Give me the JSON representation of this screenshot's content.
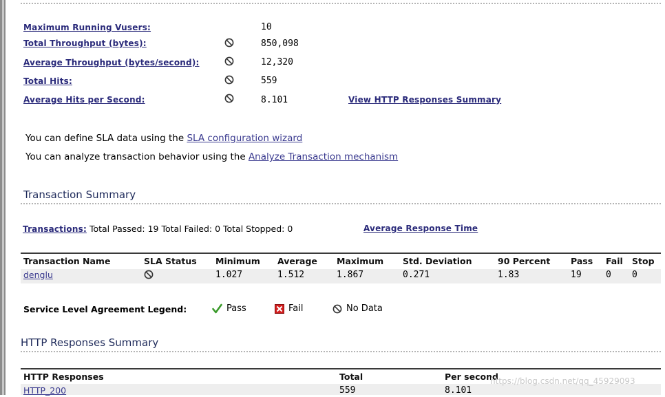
{
  "stats": [
    {
      "label": "Maximum Running Vusers:",
      "icon": "",
      "value": "10"
    },
    {
      "label": "Total Throughput (bytes):",
      "icon": "no-data-icon",
      "value": "850,098"
    },
    {
      "label": "Average Throughput (bytes/second):",
      "icon": "no-data-icon",
      "value": "12,320"
    },
    {
      "label": "Total Hits:",
      "icon": "no-data-icon",
      "value": "559"
    },
    {
      "label": "Average Hits per Second:",
      "icon": "no-data-icon",
      "value": "8.101"
    }
  ],
  "view_http_link": "View HTTP Responses Summary",
  "sla": {
    "define_prefix": "You can define SLA data using the ",
    "define_link": "SLA configuration wizard",
    "analyze_prefix": "You can analyze transaction behavior using the ",
    "analyze_link": "Analyze Transaction mechanism"
  },
  "transaction_summary": {
    "title": "Transaction Summary",
    "transactions_label": "Transactions:",
    "summary_text": "Total Passed: 19 Total Failed: 0 Total Stopped: 0",
    "avg_response_link": "Average Response Time",
    "columns": [
      "Transaction Name",
      "SLA Status",
      "Minimum",
      "Average",
      "Maximum",
      "Std. Deviation",
      "90 Percent",
      "Pass",
      "Fail",
      "Stop"
    ],
    "rows": [
      {
        "name": "denglu",
        "sla": "no-data-icon",
        "minimum": "1.027",
        "average": "1.512",
        "maximum": "1.867",
        "std": "0.271",
        "p90": "1.83",
        "pass": "19",
        "fail": "0",
        "stop": "0"
      }
    ]
  },
  "legend": {
    "title": "Service Level Agreement Legend:",
    "pass": "Pass",
    "fail": "Fail",
    "no_data": "No Data",
    "colors": {
      "pass": "#3a9a2a",
      "fail": "#d42020"
    }
  },
  "http_summary": {
    "title": "HTTP Responses Summary",
    "columns": [
      "HTTP Responses",
      "Total",
      "Per second"
    ],
    "rows": [
      {
        "response": "HTTP_200",
        "total": "559",
        "per_second": "8.101"
      }
    ]
  },
  "watermark": "https://blog.csdn.net/qq_45929093"
}
